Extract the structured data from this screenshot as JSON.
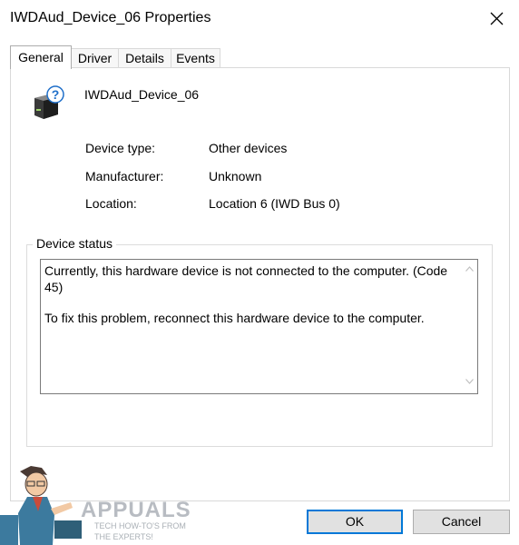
{
  "window": {
    "title": "IWDAud_Device_06 Properties",
    "close_icon": "close-icon"
  },
  "tabs": [
    {
      "label": "General",
      "active": true
    },
    {
      "label": "Driver",
      "active": false
    },
    {
      "label": "Details",
      "active": false
    },
    {
      "label": "Events",
      "active": false
    }
  ],
  "device": {
    "icon": "unknown-device-icon",
    "name": "IWDAud_Device_06"
  },
  "properties": [
    {
      "label": "Device type:",
      "value": "Other devices"
    },
    {
      "label": "Manufacturer:",
      "value": "Unknown"
    },
    {
      "label": "Location:",
      "value": "Location 6 (IWD Bus 0)"
    }
  ],
  "status": {
    "legend": "Device status",
    "lines": [
      "Currently, this hardware device is not connected to the computer. (Code 45)",
      "To fix this problem, reconnect this hardware device to the computer."
    ]
  },
  "buttons": {
    "ok": "OK",
    "cancel": "Cancel"
  },
  "watermark": {
    "brand": "APPUALS",
    "tagline_1": "TECH HOW-TO'S FROM",
    "tagline_2": "THE EXPERTS!"
  },
  "colors": {
    "accent": "#0078d7",
    "button_bg": "#e1e1e1",
    "question_mark": "#1f6fc9"
  }
}
